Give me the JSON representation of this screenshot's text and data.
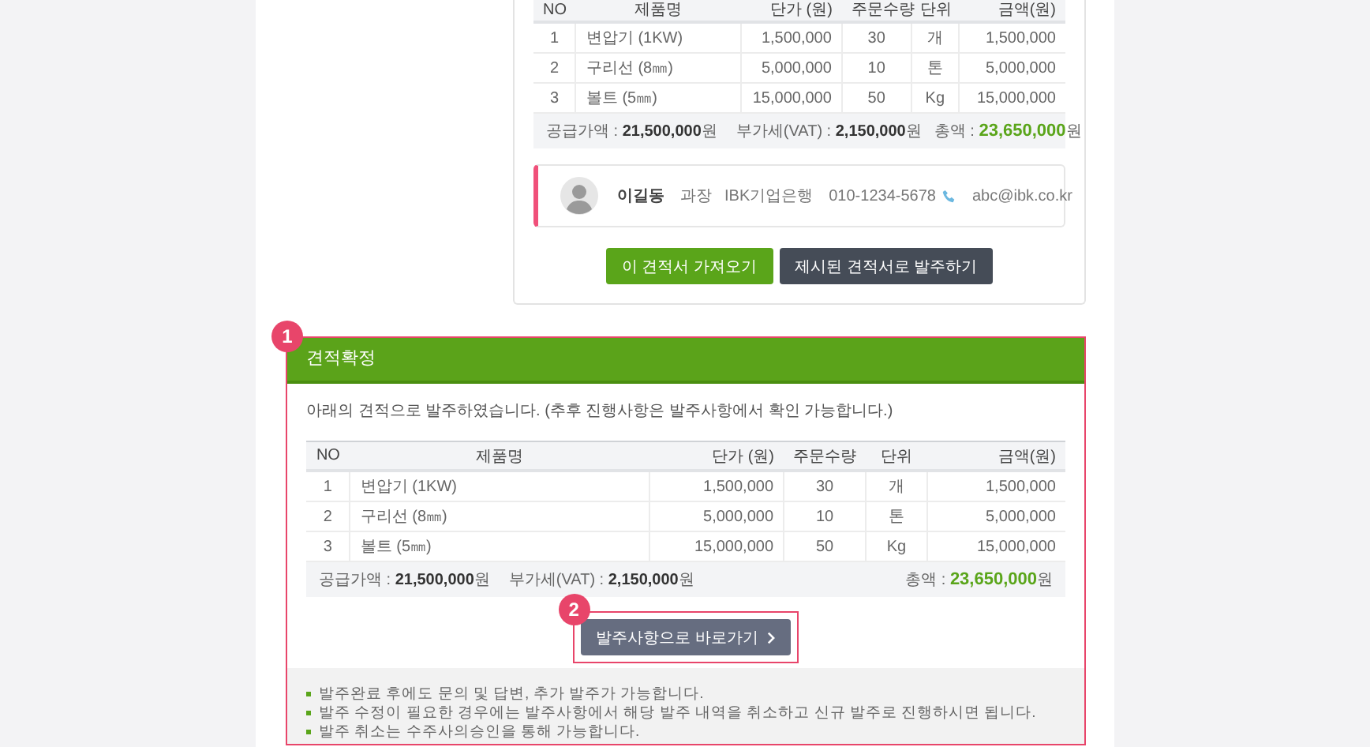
{
  "quote": {
    "table": {
      "columns": [
        "NO",
        "제품명",
        "단가 (원)",
        "주문수량",
        "단위",
        "금액(원)"
      ],
      "rows": [
        [
          "1",
          "변압기 (1KW)",
          "1,500,000",
          "30",
          "개",
          "1,500,000"
        ],
        [
          "2",
          "구리선 (8㎜)",
          "5,000,000",
          "10",
          "톤",
          "5,000,000"
        ],
        [
          "3",
          "볼트 (5㎜)",
          "15,000,000",
          "50",
          "Kg",
          "15,000,000"
        ]
      ]
    },
    "summary": {
      "supply_label": "공급가액 :",
      "supply_value": "21,500,000",
      "supply_unit": "원",
      "vat_label": "부가세(VAT) :",
      "vat_value": "2,150,000",
      "vat_unit": "원",
      "total_label": "총액 :",
      "total_value": "23,650,000",
      "total_unit": "원"
    },
    "contact": {
      "name": "이길동",
      "position": "과장",
      "company": "IBK기업은행",
      "phone": "010-1234-5678",
      "email": "abc@ibk.co.kr"
    },
    "buttons": [
      {
        "label": "이 견적서 가져오기",
        "kind": "primary"
      },
      {
        "label": "제시된 견적서로 발주하기",
        "kind": "dark"
      }
    ]
  },
  "confirmation": {
    "badge": "1",
    "title": "견적확정",
    "message": "아래의 견적으로 발주하였습니다. (추후 진행사항은 발주사항에서 확인 가능합니다.)",
    "table": {
      "columns": [
        "NO",
        "제품명",
        "단가 (원)",
        "주문수량",
        "단위",
        "금액(원)"
      ],
      "rows": [
        [
          "1",
          "변압기 (1KW)",
          "1,500,000",
          "30",
          "개",
          "1,500,000"
        ],
        [
          "2",
          "구리선 (8㎜)",
          "5,000,000",
          "10",
          "톤",
          "5,000,000"
        ],
        [
          "3",
          "볼트 (5㎜)",
          "15,000,000",
          "50",
          "Kg",
          "15,000,000"
        ]
      ]
    },
    "summary": {
      "supply_label": "공급가액 :",
      "supply_value": "21,500,000",
      "supply_unit": "원",
      "vat_label": "부가세(VAT) :",
      "vat_value": "2,150,000",
      "vat_unit": "원",
      "total_label": "총액 :",
      "total_value": "23,650,000",
      "total_unit": "원"
    },
    "button_badge": "2",
    "button": {
      "label": "발주사항으로 바로가기"
    },
    "notes": [
      "발주완료 후에도 문의 및 답변, 추가 발주가 가능합니다.",
      "발주 수정이 필요한 경우에는 발주사항에서 해당 발주 내역을 취소하고 신규 발주로 진행하시면 됩니다.",
      "발주 취소는 수주사의승인을 통해 가능합니다."
    ]
  }
}
